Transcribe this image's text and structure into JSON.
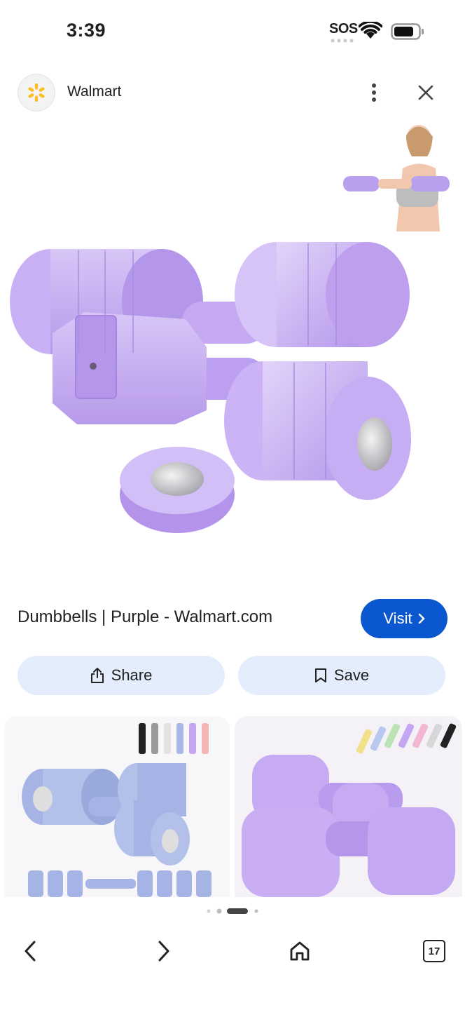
{
  "status_bar": {
    "time": "3:39",
    "sos": "SOS"
  },
  "header": {
    "site_name": "Walmart"
  },
  "result": {
    "title": "Dumbbells | Purple - Walmart.com",
    "visit_label": "Visit"
  },
  "actions": {
    "share_label": "Share",
    "save_label": "Save"
  },
  "bottom_nav": {
    "tab_count": "17"
  },
  "colors": {
    "accent": "#0b57d0",
    "chip_bg": "#e4edfc",
    "purple": "#c4a6f2"
  }
}
